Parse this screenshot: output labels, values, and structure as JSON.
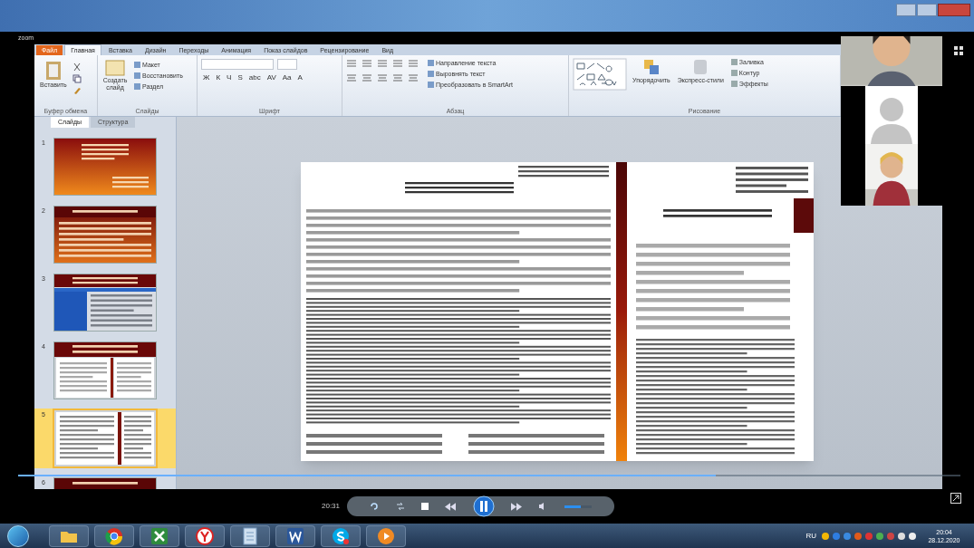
{
  "window": {
    "app_label": "zoom"
  },
  "ribbon": {
    "tabs": [
      {
        "label": "Файл",
        "kind": "file",
        "selected": false
      },
      {
        "label": "Главная",
        "kind": "tab",
        "selected": true
      },
      {
        "label": "Вставка",
        "kind": "tab",
        "selected": false
      },
      {
        "label": "Дизайн",
        "kind": "tab",
        "selected": false
      },
      {
        "label": "Переходы",
        "kind": "tab",
        "selected": false
      },
      {
        "label": "Анимация",
        "kind": "tab",
        "selected": false
      },
      {
        "label": "Показ слайдов",
        "kind": "tab",
        "selected": false
      },
      {
        "label": "Рецензирование",
        "kind": "tab",
        "selected": false
      },
      {
        "label": "Вид",
        "kind": "tab",
        "selected": false
      }
    ],
    "groups": [
      {
        "kind": "clipboard",
        "label": "Буфер обмена",
        "buttons": [
          "Вставить"
        ]
      },
      {
        "kind": "slides",
        "label": "Слайды",
        "buttons": [
          "Создать слайд",
          "Макет",
          "Восстановить",
          "Раздел"
        ]
      },
      {
        "kind": "font",
        "label": "Шрифт",
        "buttons": [
          "Ж",
          "К",
          "Ч",
          "S",
          "abc",
          "AV",
          "Aa",
          "A"
        ]
      },
      {
        "kind": "paragraph",
        "label": "Абзац",
        "buttons": [
          "Направление текста",
          "Выровнять текст",
          "Преобразовать в SmartArt"
        ]
      },
      {
        "kind": "drawing",
        "label": "Рисование",
        "buttons": [
          "Упорядочить",
          "Экспресс-стили",
          "Заливка",
          "Контур",
          "Эффекты"
        ]
      }
    ]
  },
  "slide_panel": {
    "tabs": [
      {
        "label": "Слайды",
        "selected": true
      },
      {
        "label": "Структура",
        "selected": false
      }
    ],
    "slides": [
      {
        "number": "1",
        "kind": "title",
        "selected": false
      },
      {
        "number": "2",
        "kind": "list",
        "selected": false
      },
      {
        "number": "3",
        "kind": "table",
        "selected": false
      },
      {
        "number": "4",
        "kind": "docs",
        "selected": false
      },
      {
        "number": "5",
        "kind": "forms",
        "selected": true
      },
      {
        "number": "6",
        "kind": "list",
        "selected": false
      }
    ]
  },
  "participants": [
    {
      "kind": "video"
    },
    {
      "kind": "avatar"
    },
    {
      "kind": "video"
    }
  ],
  "player": {
    "time": "20:31",
    "level": 0.74,
    "volume": {
      "level": 0.6
    }
  },
  "taskbar": {
    "apps": [
      {
        "kind": "folder"
      },
      {
        "kind": "browser"
      },
      {
        "kind": "sheet"
      },
      {
        "kind": "yandex"
      },
      {
        "kind": "notes"
      },
      {
        "kind": "word"
      },
      {
        "kind": "skype"
      },
      {
        "kind": "media"
      }
    ],
    "language": "RU",
    "time": "20:04",
    "date": "28.12.2020"
  }
}
